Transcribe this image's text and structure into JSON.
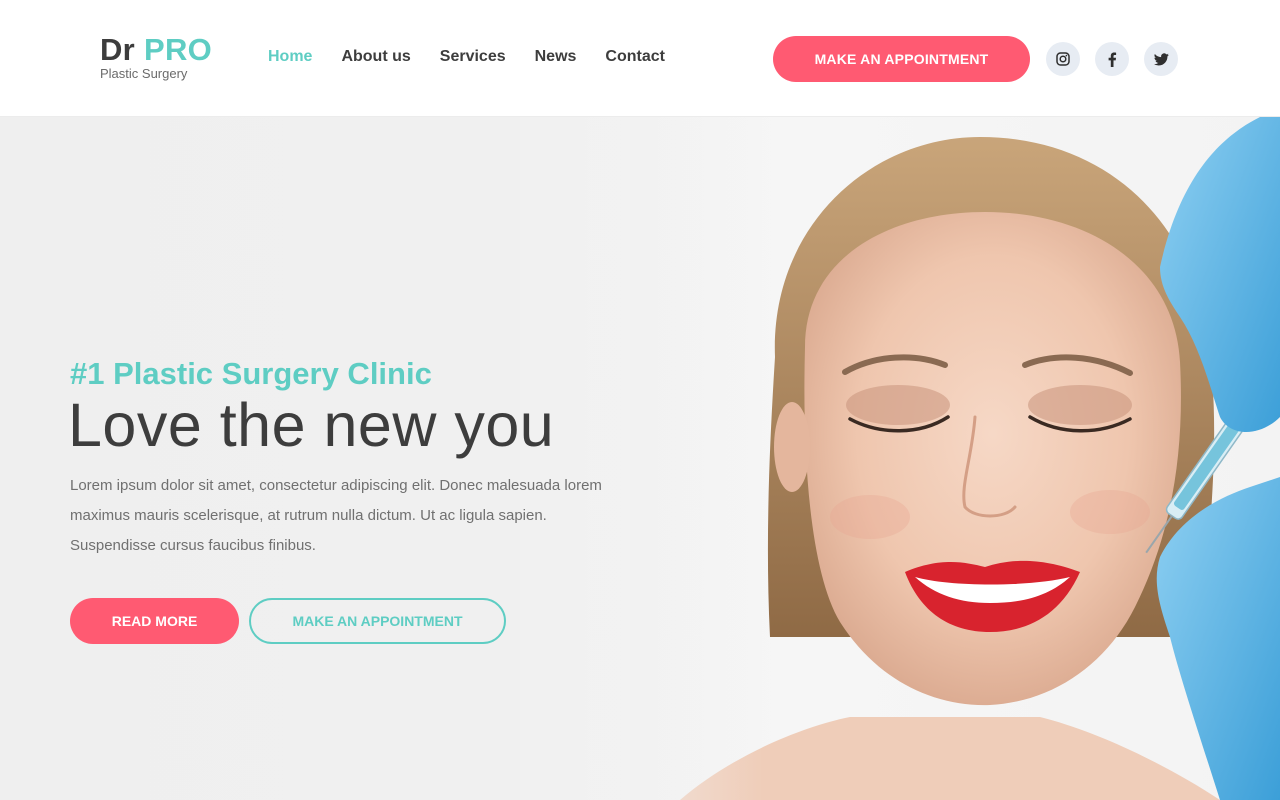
{
  "brand": {
    "name_part1": "Dr",
    "name_part2": "PRO",
    "tagline": "Plastic Surgery",
    "accent_color": "#5ecdc3",
    "cta_color": "#ff5a72"
  },
  "nav": {
    "items": [
      {
        "label": "Home",
        "active": true
      },
      {
        "label": "About us",
        "active": false
      },
      {
        "label": "Services",
        "active": false
      },
      {
        "label": "News",
        "active": false
      },
      {
        "label": "Contact",
        "active": false
      }
    ]
  },
  "header": {
    "cta_label": "MAKE AN APPOINTMENT",
    "social": [
      "instagram-icon",
      "facebook-icon",
      "twitter-icon"
    ]
  },
  "hero": {
    "kicker": "#1 Plastic Surgery Clinic",
    "headline": "Love the new you",
    "description": "Lorem ipsum dolor sit amet, consectetur adipiscing elit. Donec malesuada lorem maximus mauris scelerisque, at rutrum nulla dictum. Ut ac ligula sapien. Suspendisse cursus faucibus finibus.",
    "primary_button": "READ MORE",
    "secondary_button": "MAKE AN APPOINTMENT"
  }
}
